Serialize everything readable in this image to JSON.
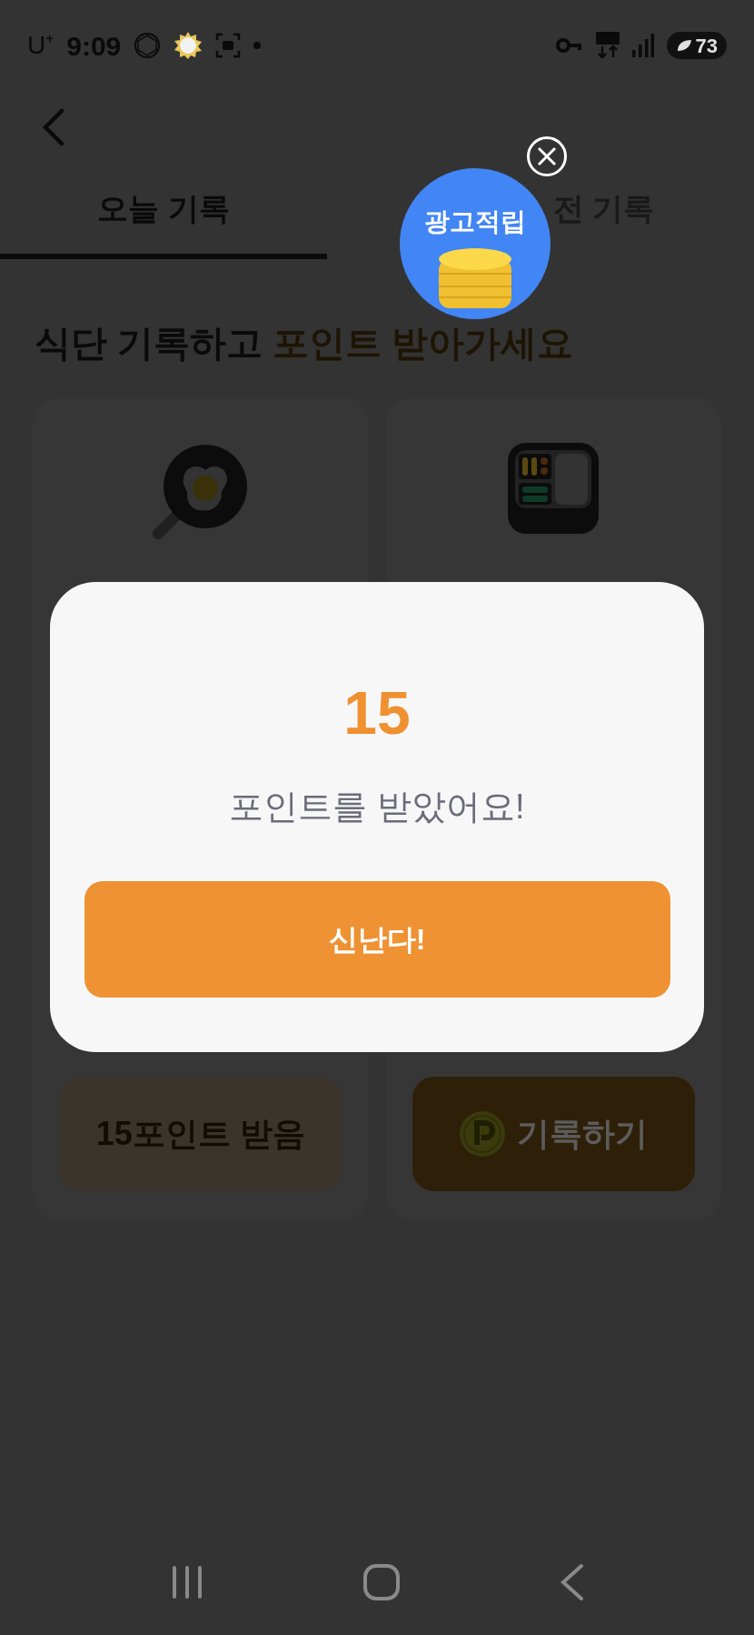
{
  "status_bar": {
    "carrier": "U⁺",
    "time": "9:09",
    "battery": "73"
  },
  "tabs": [
    {
      "label": "오늘 기록",
      "selected": true
    },
    {
      "label": "전 기록",
      "selected": false
    }
  ],
  "heading": {
    "text": "식단 기록하고",
    "highlight": "포인트 받아가세요"
  },
  "cards": [
    {
      "kind": "completed",
      "button": "15포인트 받음"
    },
    {
      "kind": "pending",
      "button": "기록하기"
    }
  ],
  "ad": {
    "label": "광고적립"
  },
  "dialog": {
    "points": "15",
    "message": "포인트를 받았어요!",
    "button": "신난다!"
  }
}
